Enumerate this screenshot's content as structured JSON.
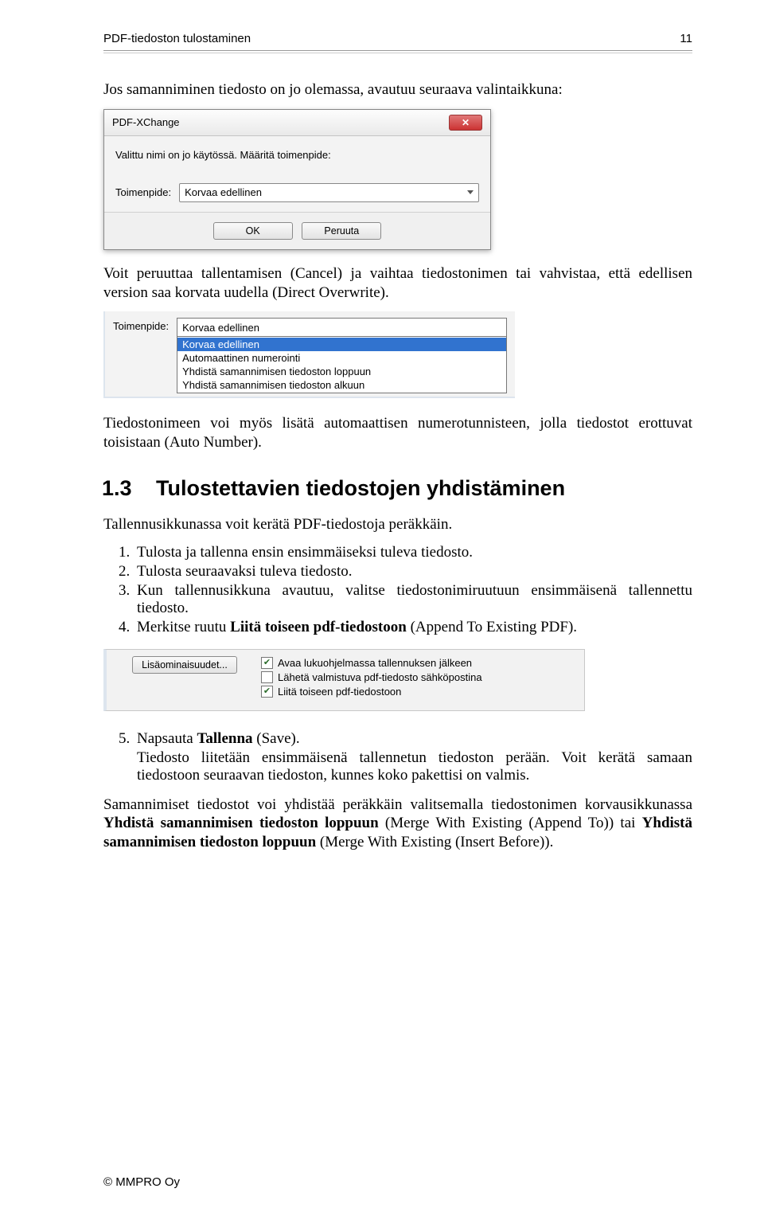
{
  "header": {
    "title": "PDF-tiedoston tulostaminen",
    "page": "11"
  },
  "intro": "Jos samanniminen tiedosto on jo olemassa, avautuu seuraava valintaikkuna:",
  "dialog1": {
    "title": "PDF-XChange",
    "message": "Valittu nimi on jo käytössä. Määritä toimenpide:",
    "field_label": "Toimenpide:",
    "field_value": "Korvaa edellinen",
    "ok": "OK",
    "cancel": "Peruuta",
    "close": "✕"
  },
  "para_after_dlg1": "Voit peruuttaa tallentamisen (Cancel) ja vaihtaa tiedostonimen tai vahvistaa, että edellisen version saa korvata uudella (Direct Overwrite).",
  "dialog2": {
    "label": "Toimenpide:",
    "selected": "Korvaa edellinen",
    "options": [
      "Korvaa edellinen",
      "Automaattinen numerointi",
      "Yhdistä samannimisen tiedoston loppuun",
      "Yhdistä samannimisen tiedoston alkuun"
    ]
  },
  "para_after_dlg2": "Tiedostonimeen voi myös lisätä automaattisen numerotunnisteen, jolla tiedostot erottuvat toisistaan (Auto Number).",
  "section": {
    "num": "1.3",
    "title": "Tulostettavien tiedostojen yhdistäminen"
  },
  "para_section": "Tallennusikkunassa voit kerätä PDF-tiedostoja peräkkäin.",
  "steps1": [
    "Tulosta ja tallenna ensin ensimmäiseksi tuleva tiedosto.",
    "Tulosta seuraavaksi tuleva tiedosto.",
    "Kun tallennusikkuna avautuu, valitse tiedostonimiruutuun ensimmäisenä tallennettu tiedosto.",
    "Merkitse ruutu Liitä toiseen pdf-tiedostoon (Append To Existing PDF)."
  ],
  "steps1_strong": "Liitä toiseen pdf-tiedostoon",
  "dialog3": {
    "button": "Lisäominaisuudet...",
    "checks": [
      {
        "checked": true,
        "label": "Avaa lukuohjelmassa tallennuksen jälkeen"
      },
      {
        "checked": false,
        "label": "Lähetä valmistuva pdf-tiedosto sähköpostina"
      },
      {
        "checked": true,
        "label": "Liitä toiseen pdf-tiedostoon"
      }
    ]
  },
  "steps2": {
    "start": "Napsauta ",
    "strong": "Tallenna",
    "end": " (Save).",
    "detail": "Tiedosto liitetään ensimmäisenä tallennetun tiedoston perään. Voit kerätä samaan tiedostoon seuraavan tiedoston, kunnes koko pakettisi on valmis."
  },
  "final_para": {
    "a": "Samannimiset tiedostot voi yhdistää peräkkäin valitsemalla tiedostonimen korvausikkunassa ",
    "b1": "Yhdistä samannimisen tiedoston loppuun",
    "c": " (Merge With Existing (Append To)) tai ",
    "b2": "Yhdistä samannimisen tiedoston loppuun",
    "d": " (Merge With Existing (Insert Before))."
  },
  "footer": "© MMPRO Oy"
}
